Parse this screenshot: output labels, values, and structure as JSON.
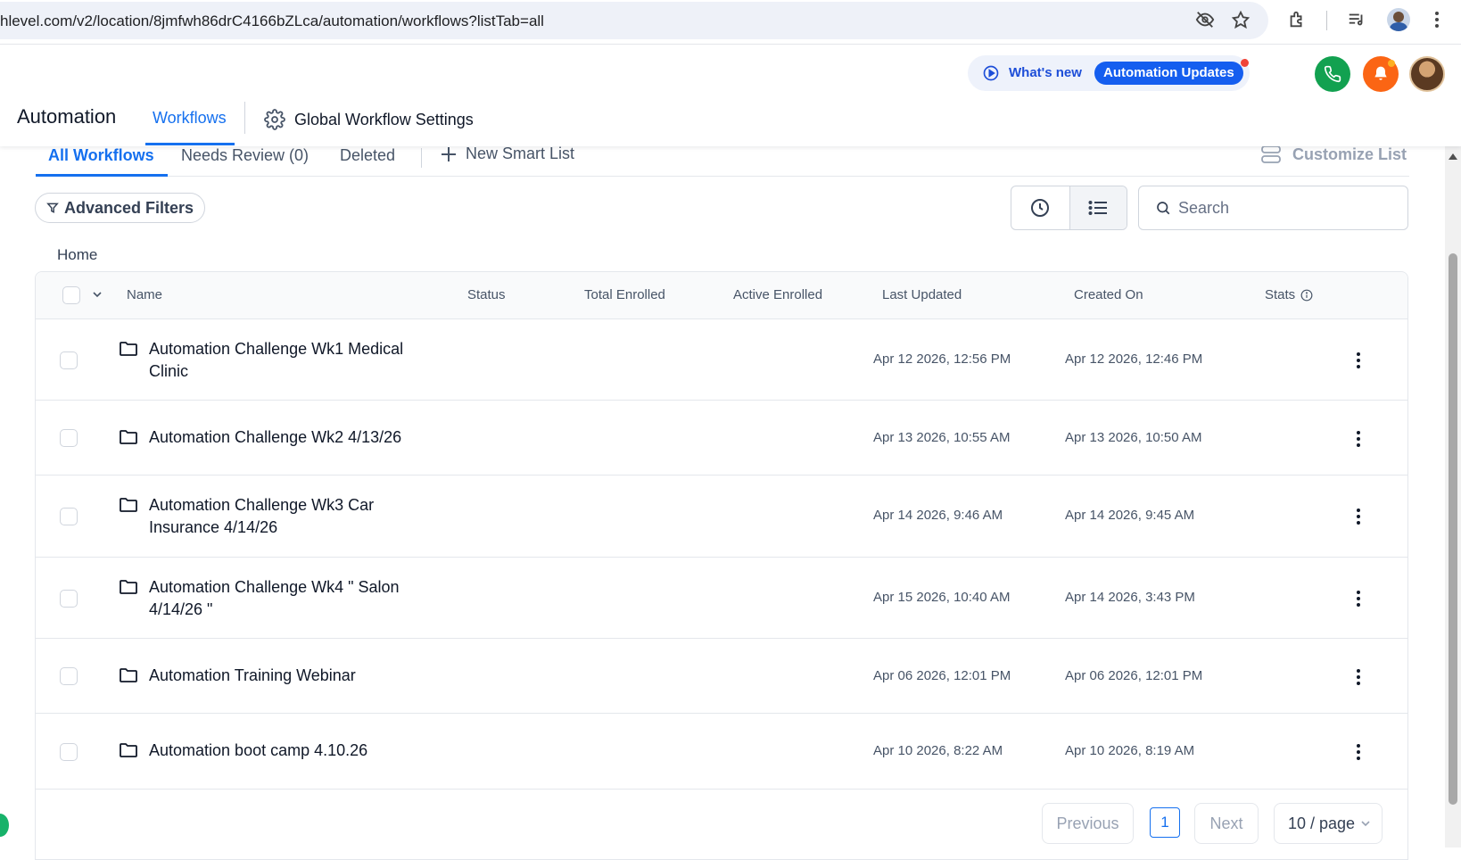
{
  "browser": {
    "url": "hlevel.com/v2/location/8jmfwh86drC4166bZLca/automation/workflows?listTab=all"
  },
  "header": {
    "whats_new": "What's new",
    "updates_badge": "Automation Updates"
  },
  "nav": {
    "module_title": "Automation",
    "tab_workflows": "Workflows",
    "global_settings": "Global Workflow Settings"
  },
  "sub_tabs": {
    "all": "All Workflows",
    "needs_review": "Needs Review (0)",
    "deleted": "Deleted",
    "new_smart_list": "New Smart List",
    "customize_list": "Customize List"
  },
  "filters": {
    "advanced": "Advanced Filters",
    "search_placeholder": "Search"
  },
  "breadcrumb": "Home",
  "table": {
    "columns": [
      "Name",
      "Status",
      "Total Enrolled",
      "Active Enrolled",
      "Last Updated",
      "Created On",
      "Stats"
    ],
    "rows": [
      {
        "name": "Automation Challenge Wk1 Medical Clinic",
        "last_updated": "Apr 12 2026, 12:56 PM",
        "created_on": "Apr 12 2026, 12:46 PM"
      },
      {
        "name": "Automation Challenge Wk2 4/13/26",
        "last_updated": "Apr 13 2026, 10:55 AM",
        "created_on": "Apr 13 2026, 10:50 AM"
      },
      {
        "name": "Automation Challenge Wk3 Car Insurance 4/14/26",
        "last_updated": "Apr 14 2026, 9:46 AM",
        "created_on": "Apr 14 2026, 9:45 AM"
      },
      {
        "name": "Automation Challenge Wk4 \" Salon 4/14/26 \"",
        "last_updated": "Apr 15 2026, 10:40 AM",
        "created_on": "Apr 14 2026, 3:43 PM"
      },
      {
        "name": "Automation Training Webinar",
        "last_updated": "Apr 06 2026, 12:01 PM",
        "created_on": "Apr 06 2026, 12:01 PM"
      },
      {
        "name": "Automation boot camp 4.10.26",
        "last_updated": "Apr 10 2026, 8:22 AM",
        "created_on": "Apr 10 2026, 8:19 AM"
      }
    ]
  },
  "pagination": {
    "previous": "Previous",
    "current_page": "1",
    "next": "Next",
    "per_page": "10 / page"
  },
  "colors": {
    "accent": "#1570ef",
    "phone": "#12a150",
    "bell": "#fb6514",
    "badge": "#155eef"
  }
}
